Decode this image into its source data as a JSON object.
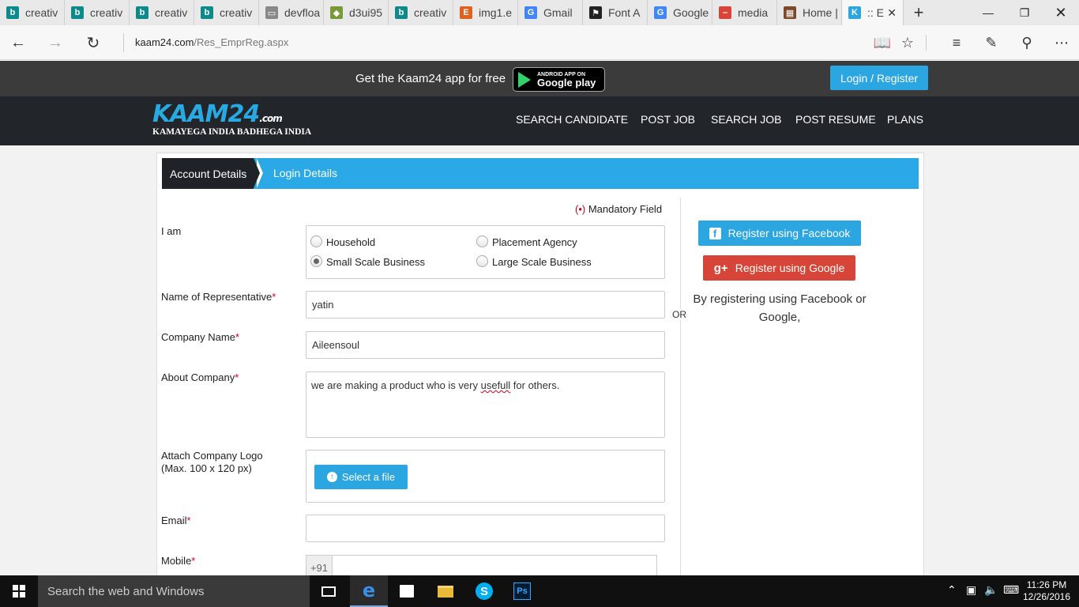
{
  "browser": {
    "tabs": [
      {
        "label": "creativ",
        "icon": "bing-icon",
        "color": "#0f8a8a"
      },
      {
        "label": "creativ",
        "icon": "bing-icon",
        "color": "#0f8a8a"
      },
      {
        "label": "creativ",
        "icon": "bing-icon",
        "color": "#0f8a8a"
      },
      {
        "label": "creativ",
        "icon": "bing-icon",
        "color": "#0f8a8a"
      },
      {
        "label": "devfloa",
        "icon": "page-icon",
        "color": "#888888"
      },
      {
        "label": "d3ui95",
        "icon": "puzzle-icon",
        "color": "#7a9a3a"
      },
      {
        "label": "creativ",
        "icon": "bing-icon",
        "color": "#0f8a8a"
      },
      {
        "label": "img1.e",
        "icon": "etsy-icon",
        "color": "#e0611f"
      },
      {
        "label": "Gmail",
        "icon": "google-icon",
        "color": "#4285f4"
      },
      {
        "label": "Font A",
        "icon": "flag-icon",
        "color": "#222222"
      },
      {
        "label": "Google",
        "icon": "google-icon",
        "color": "#4285f4"
      },
      {
        "label": "media",
        "icon": "media-icon",
        "color": "#d64537"
      },
      {
        "label": "Home |",
        "icon": "site-icon",
        "color": "#7a4a2a"
      },
      {
        "label": ":: E",
        "icon": "kaam24-icon",
        "color": "#2ba6e1"
      }
    ],
    "url_domain": "kaam24.com",
    "url_path": "/Res_EmprReg.aspx"
  },
  "promo": {
    "text": "Get the Kaam24 app for free",
    "badge_small": "ANDROID APP ON",
    "badge_big": "Google play",
    "login_button": "Login / Register"
  },
  "header": {
    "logo_main": "KAAM24",
    "logo_com": ".com",
    "logo_tagline": "KAMAYEGA INDIA BADHEGA INDIA",
    "nav": [
      "SEARCH CANDIDATE",
      "POST JOB",
      "SEARCH JOB",
      "POST RESUME",
      "PLANS"
    ]
  },
  "steps": {
    "step1": "Account Details",
    "step2": "Login Details"
  },
  "form": {
    "mandatory_mark": "(•)",
    "mandatory_label": "Mandatory Field",
    "iam_label": "I am",
    "options": [
      {
        "label": "Household",
        "selected": false
      },
      {
        "label": "Placement Agency",
        "selected": false
      },
      {
        "label": "Small Scale Business",
        "selected": true
      },
      {
        "label": "Large Scale Business",
        "selected": false
      }
    ],
    "rep_label": "Name of Representative",
    "rep_value": "yatin",
    "company_label": "Company Name",
    "company_value": "Aileensoul",
    "about_label": "About Company",
    "about_before": "we are making a product who is very ",
    "about_misspelled": "usefull",
    "about_after": " for others.",
    "logo_label_1": "Attach Company Logo",
    "logo_label_2": "(Max. 100 x 120 px)",
    "select_file": "Select a file",
    "email_label": "Email",
    "email_value": "",
    "mobile_label": "Mobile",
    "mobile_code": "+91",
    "required_mark": "*"
  },
  "social": {
    "or": "OR",
    "facebook": "Register using Facebook",
    "google": "Register using Google",
    "note": "By registering using Facebook or Google,"
  },
  "taskbar": {
    "search_placeholder": "Search the web and Windows",
    "time": "11:26 PM",
    "date": "12/26/2016"
  }
}
